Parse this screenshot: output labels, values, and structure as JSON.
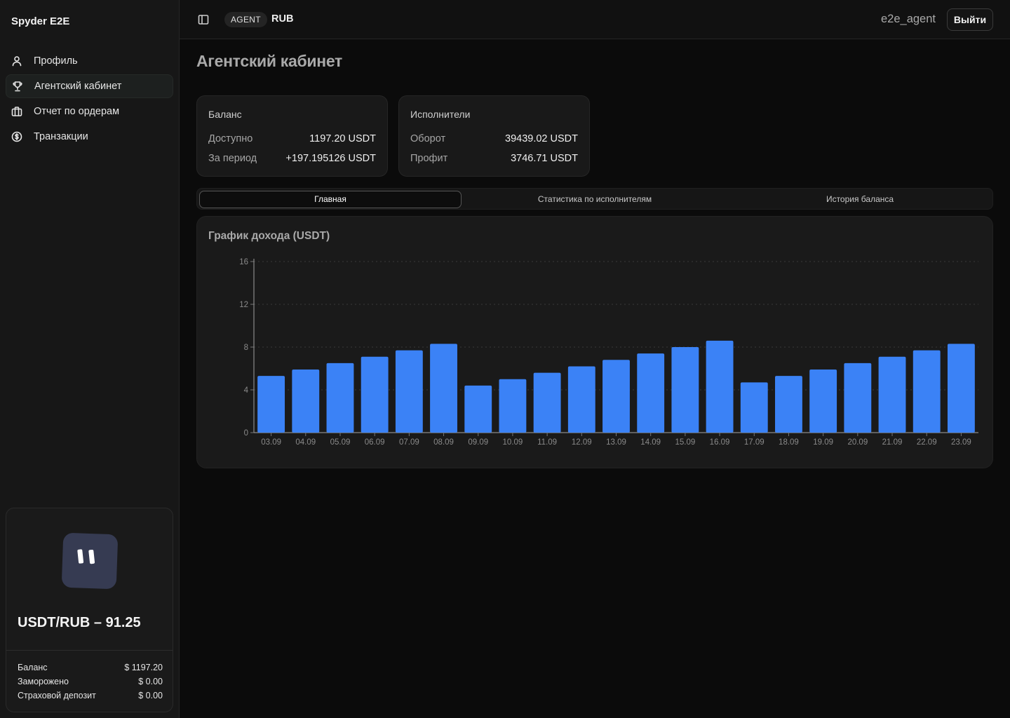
{
  "app": {
    "name": "Spyder E2E"
  },
  "sidebar": {
    "items": [
      {
        "label": "Профиль",
        "icon": "user-icon",
        "active": false
      },
      {
        "label": "Агентский кабинет",
        "icon": "trophy-icon",
        "active": true
      },
      {
        "label": "Отчет по ордерам",
        "icon": "briefcase-icon",
        "active": false
      },
      {
        "label": "Транзакции",
        "icon": "dollar-circle-icon",
        "active": false
      }
    ],
    "rate_card": {
      "title": "USDT/RUB – 91.25",
      "rows": [
        {
          "label": "Баланс",
          "value": "$ 1197.20"
        },
        {
          "label": "Заморожено",
          "value": "$ 0.00"
        },
        {
          "label": "Страховой депозит",
          "value": "$ 0.00"
        }
      ]
    }
  },
  "header": {
    "role": "AGENT",
    "currency": "RUB",
    "username": "e2e_agent",
    "logout_label": "Выйти"
  },
  "main": {
    "title": "Агентский кабинет",
    "balance_card": {
      "title": "Баланс",
      "rows": [
        {
          "label": "Доступно",
          "value": "1197.20 USDT"
        },
        {
          "label": "За период",
          "value": "+197.195126 USDT"
        }
      ]
    },
    "performers_card": {
      "title": "Исполнители",
      "rows": [
        {
          "label": "Оборот",
          "value": "39439.02 USDT"
        },
        {
          "label": "Профит",
          "value": "3746.71 USDT"
        }
      ]
    },
    "tabs": [
      {
        "label": "Главная",
        "active": true
      },
      {
        "label": "Статистика по исполнителям",
        "active": false
      },
      {
        "label": "История баланса",
        "active": false
      }
    ]
  },
  "colors": {
    "bar": "#3b82f6",
    "background": "#0b0b0b",
    "card": "#1a1a1a"
  },
  "chart_data": {
    "type": "bar",
    "title": "График дохода (USDT)",
    "xlabel": "",
    "ylabel": "",
    "categories": [
      "03.09",
      "04.09",
      "05.09",
      "06.09",
      "07.09",
      "08.09",
      "09.09",
      "10.09",
      "11.09",
      "12.09",
      "13.09",
      "14.09",
      "15.09",
      "16.09",
      "17.09",
      "18.09",
      "19.09",
      "20.09",
      "21.09",
      "22.09",
      "23.09"
    ],
    "values": [
      5.3,
      5.9,
      6.5,
      7.1,
      7.7,
      8.3,
      4.4,
      5.0,
      5.6,
      6.2,
      6.8,
      7.4,
      8.0,
      8.6,
      4.7,
      5.3,
      5.9,
      6.5,
      7.1,
      7.7,
      8.3
    ],
    "yticks": [
      0,
      4,
      8,
      12,
      16
    ],
    "ylim": [
      0,
      16
    ],
    "grid": true,
    "legend": false
  }
}
